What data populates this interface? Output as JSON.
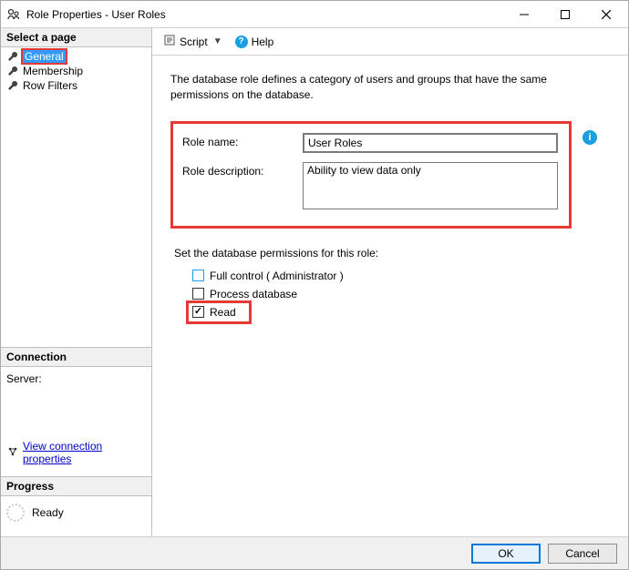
{
  "window": {
    "title": "Role Properties - User Roles"
  },
  "sidebar": {
    "select_page_header": "Select a page",
    "pages": [
      {
        "label": "General"
      },
      {
        "label": "Membership"
      },
      {
        "label": "Row Filters"
      }
    ],
    "connection_header": "Connection",
    "server_label": "Server:",
    "view_conn_link": "View connection properties",
    "progress_header": "Progress",
    "progress_status": "Ready"
  },
  "toolbar": {
    "script_label": "Script",
    "help_label": "Help"
  },
  "content": {
    "intro": "The database role defines a category of users and groups that have the same permissions on the database.",
    "role_name_label": "Role name:",
    "role_name_value": "User Roles",
    "role_desc_label": "Role description:",
    "role_desc_value": "Ability to view data only",
    "perm_label": "Set the database permissions for this role:",
    "checkboxes": {
      "full_control": {
        "label": "Full control ( Administrator )",
        "checked": false
      },
      "process_db": {
        "label": "Process database",
        "checked": false
      },
      "read": {
        "label": "Read",
        "checked": true
      }
    }
  },
  "buttons": {
    "ok": "OK",
    "cancel": "Cancel"
  }
}
